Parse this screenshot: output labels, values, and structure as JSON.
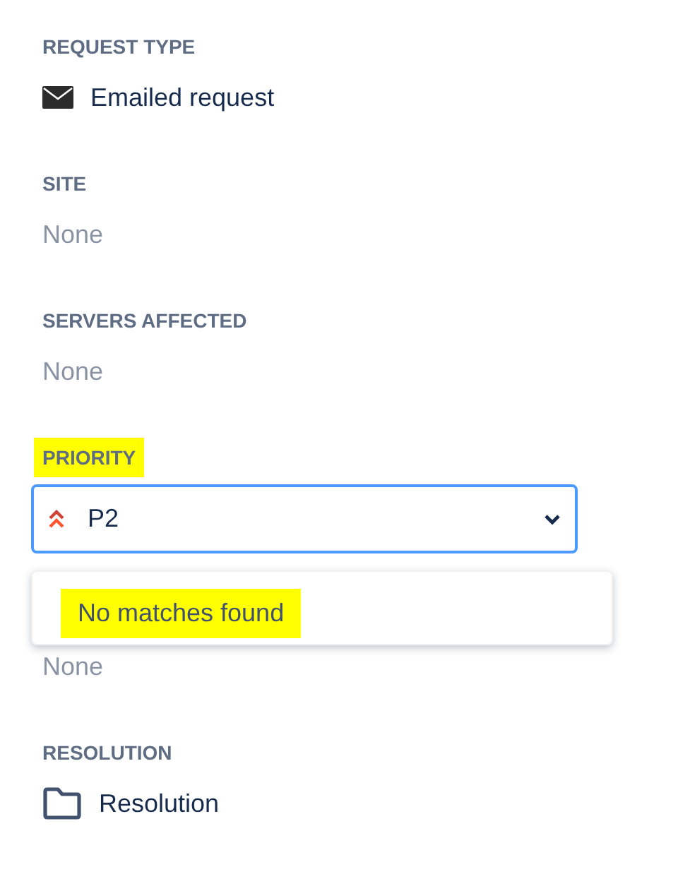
{
  "fields": [
    {
      "kind": "mail-value",
      "label": "REQUEST TYPE",
      "value": "Emailed request"
    },
    {
      "kind": "empty",
      "label": "SITE",
      "value": "None"
    },
    {
      "kind": "empty",
      "label": "SERVERS AFFECTED",
      "value": "None"
    },
    {
      "kind": "select",
      "label": "PRIORITY",
      "label_highlighted": true,
      "value": "P2",
      "focused": true,
      "menu": {
        "message": "No matches found",
        "highlighted": true
      }
    },
    {
      "kind": "empty",
      "value": "None"
    },
    {
      "kind": "folder-value",
      "label": "RESOLUTION",
      "value": "Resolution"
    }
  ]
}
